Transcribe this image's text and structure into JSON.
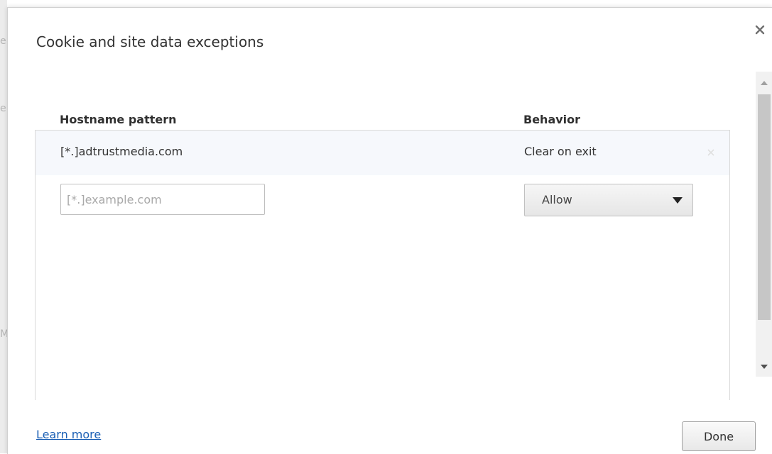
{
  "dialog": {
    "title": "Cookie and site data exceptions"
  },
  "columns": {
    "hostname_header": "Hostname pattern",
    "behavior_header": "Behavior"
  },
  "exceptions": [
    {
      "hostname": "[*.]adtrustmedia.com",
      "behavior": "Clear on exit"
    }
  ],
  "new_exception": {
    "hostname_value": "",
    "hostname_placeholder": "[*.]example.com",
    "behavior_selected": "Allow"
  },
  "footer": {
    "learn_more_label": "Learn more",
    "done_label": "Done"
  },
  "icons": {
    "close": "close-icon",
    "delete_row": "close-icon",
    "dropdown": "chevron-down-icon",
    "scroll_up": "arrow-up-icon",
    "scroll_down": "arrow-down-icon"
  },
  "colors": {
    "link": "#1a5fb4",
    "selected_row_bg": "#f6f8fc",
    "border": "#d9d9d9"
  }
}
